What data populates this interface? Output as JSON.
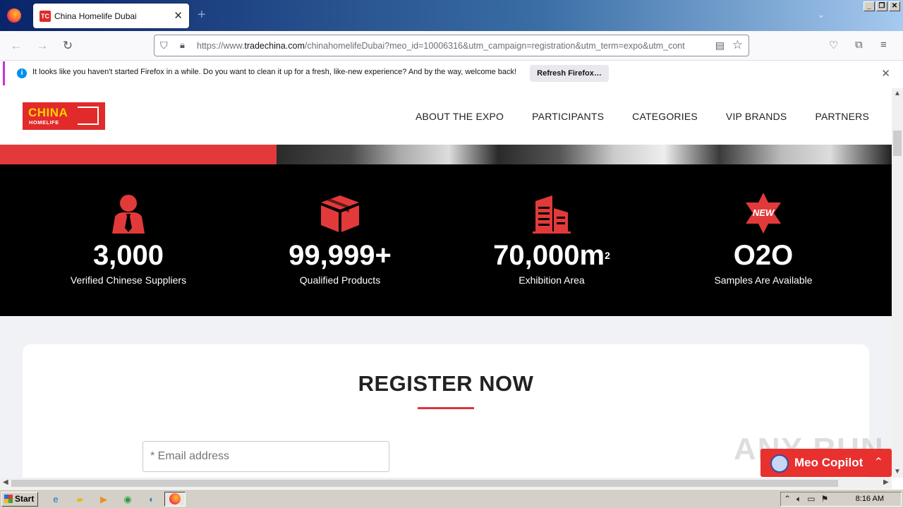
{
  "browser": {
    "tab_title": "China Homelife Dubai",
    "tab_favicon_text": "TC",
    "url_prefix": "https://www.",
    "url_domain": "tradechina.com",
    "url_rest": "/chinahomelifeDubai?meo_id=10006316&utm_campaign=registration&utm_term=expo&utm_cont",
    "notification_text": "It looks like you haven't started Firefox in a while. Do you want to clean it up for a fresh, like-new experience? And by the way, welcome back!",
    "notification_button": "Refresh Firefox…"
  },
  "site": {
    "logo_top": "CHINA",
    "logo_bottom": "HOMELIFE",
    "menu": [
      "ABOUT THE EXPO",
      "PARTICIPANTS",
      "CATEGORIES",
      "VIP BRANDS",
      "PARTNERS"
    ],
    "accent_color": "#e23a3a"
  },
  "stats": [
    {
      "icon": "person-tie-icon",
      "value": "3,000",
      "label": "Verified Chinese Suppliers"
    },
    {
      "icon": "box-icon",
      "value": "99,999+",
      "label": "Qualified Products"
    },
    {
      "icon": "buildings-icon",
      "value": "70,000m",
      "unit_sup": "2",
      "label": "Exhibition Area"
    },
    {
      "icon": "new-star-icon",
      "value": "O2O",
      "label": "Samples Are Available",
      "icon_text": "NEW"
    }
  ],
  "register": {
    "title": "REGISTER NOW",
    "email_placeholder": "* Email address"
  },
  "copilot": {
    "label": "Meo Copilot"
  },
  "watermark": "ANY RUN",
  "taskbar": {
    "start_label": "Start",
    "clock": "8:16 AM"
  }
}
